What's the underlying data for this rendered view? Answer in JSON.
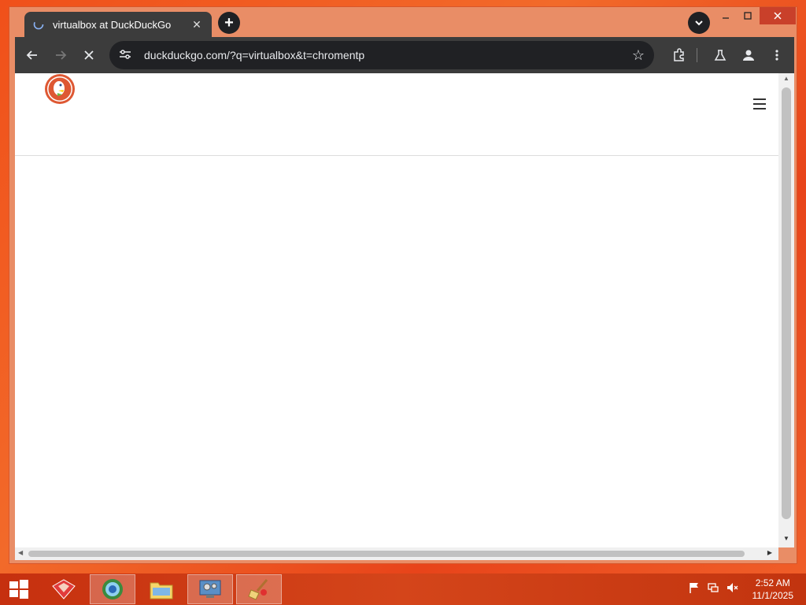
{
  "browser": {
    "tab_title": "virtualbox at DuckDuckGo",
    "url": "duckduckgo.com/?q=virtualbox&t=chromentp"
  },
  "taskbar": {
    "time": "2:52 AM",
    "date": "11/1/2025"
  },
  "icons": {
    "back": "arrow-left-icon",
    "forward": "arrow-right-icon",
    "stop": "close-icon",
    "site_info": "tune-icon",
    "bookmark": "star-icon",
    "extensions": "puzzle-icon",
    "labs": "flask-icon",
    "profile": "person-icon",
    "menu": "more-vert-icon"
  },
  "colors": {
    "accent": "#3c3c3c",
    "desktop": "#f0501a",
    "ddg": "#de5833"
  }
}
